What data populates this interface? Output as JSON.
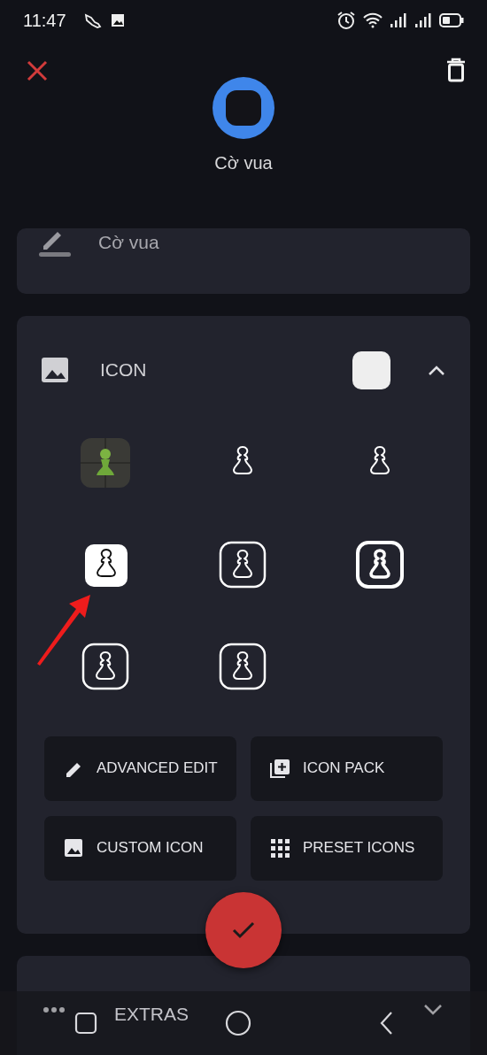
{
  "status_bar": {
    "time": "11:47"
  },
  "header": {
    "app_label": "Cờ vua"
  },
  "name_field": {
    "value": "Cờ vua"
  },
  "icon_section": {
    "title": "ICON",
    "expanded": true,
    "icons": [
      {
        "kind": "app"
      },
      {
        "kind": "bare"
      },
      {
        "kind": "bare"
      },
      {
        "kind": "filled"
      },
      {
        "kind": "outlined"
      },
      {
        "kind": "outlined-bold"
      },
      {
        "kind": "outlined"
      },
      {
        "kind": "outlined"
      }
    ],
    "buttons": [
      {
        "label": "ADVANCED EDIT"
      },
      {
        "label": "ICON PACK"
      },
      {
        "label": "CUSTOM ICON"
      },
      {
        "label": "PRESET ICONS"
      }
    ]
  },
  "extras_section": {
    "title": "EXTRAS"
  }
}
